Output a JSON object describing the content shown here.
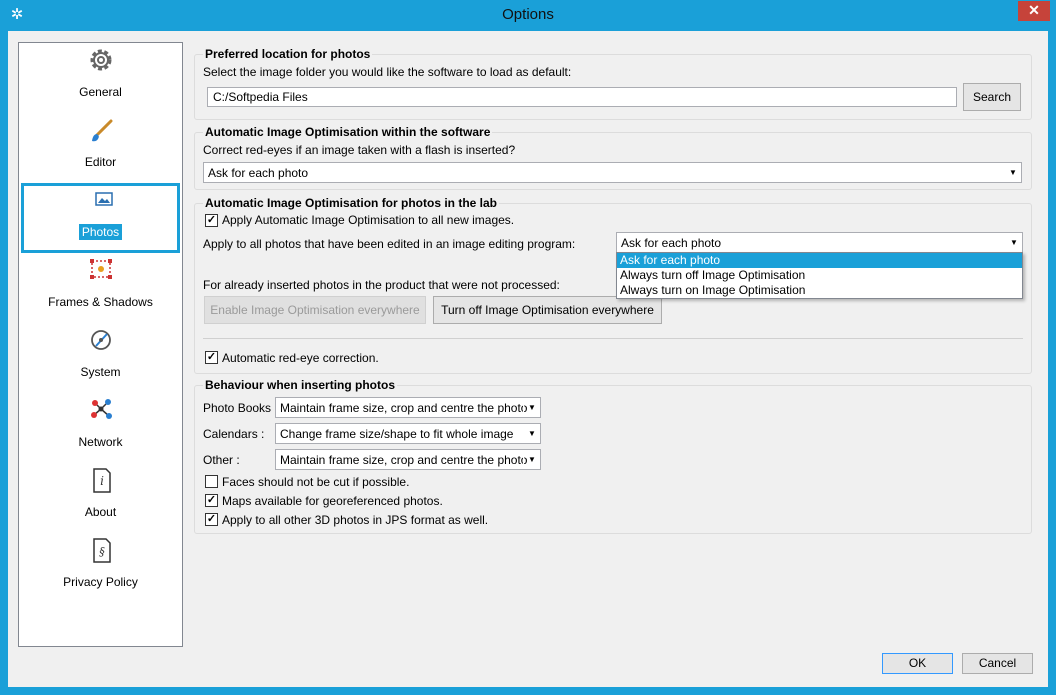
{
  "window": {
    "title": "Options",
    "close_label": "✕"
  },
  "sidebar": {
    "items": [
      {
        "label": "General",
        "icon": "gear-icon"
      },
      {
        "label": "Editor",
        "icon": "brush-icon"
      },
      {
        "label": "Photos",
        "icon": "photo-icon"
      },
      {
        "label": "Frames & Shadows",
        "icon": "frame-icon"
      },
      {
        "label": "System",
        "icon": "system-icon"
      },
      {
        "label": "Network",
        "icon": "network-icon"
      },
      {
        "label": "About",
        "icon": "info-icon"
      },
      {
        "label": "Privacy Policy",
        "icon": "policy-icon"
      }
    ],
    "selected": "Photos"
  },
  "preferred_location": {
    "title": "Preferred location for photos",
    "desc": "Select the image folder you would like the software to load as default:",
    "path_value": "C:/Softpedia Files",
    "search_label": "Search"
  },
  "auto_opt_software": {
    "title": "Automatic Image Optimisation within the software",
    "desc": "Correct red-eyes if an image taken with a flash is inserted?",
    "select_value": "Ask for each photo"
  },
  "auto_opt_lab": {
    "title": "Automatic Image Optimisation for photos in the lab",
    "apply_new_label": "Apply Automatic Image Optimisation to all new images.",
    "apply_new_checked": true,
    "apply_edited_label": "Apply to all photos that have been edited in an image editing program:",
    "edited_select_value": "Ask for each photo",
    "dropdown_options": [
      "Ask for each photo",
      "Always turn off Image Optimisation",
      "Always turn on Image Optimisation"
    ],
    "already_inserted_label": "For already inserted photos in the product that were not processed:",
    "enable_everywhere_label": "Enable Image Optimisation everywhere",
    "turn_off_everywhere_label": "Turn off Image Optimisation everywhere",
    "redeye_label": "Automatic red-eye correction.",
    "redeye_checked": true
  },
  "behaviour": {
    "title": "Behaviour when inserting photos",
    "photo_books_label": "Photo Books :",
    "photo_books_value": "Maintain frame size, crop and centre the photo",
    "calendars_label": "Calendars :",
    "calendars_value": "Change frame size/shape to fit whole image",
    "other_label": "Other :",
    "other_value": "Maintain frame size, crop and centre the photo",
    "faces_label": "Faces should not be cut if possible.",
    "faces_checked": false,
    "maps_label": "Maps available for georeferenced photos.",
    "maps_checked": true,
    "jps_label": "Apply to all other 3D photos in JPS format as well.",
    "jps_checked": true
  },
  "footer": {
    "ok_label": "OK",
    "cancel_label": "Cancel"
  },
  "colors": {
    "accent": "#1aa0d8",
    "close": "#c6433a"
  }
}
